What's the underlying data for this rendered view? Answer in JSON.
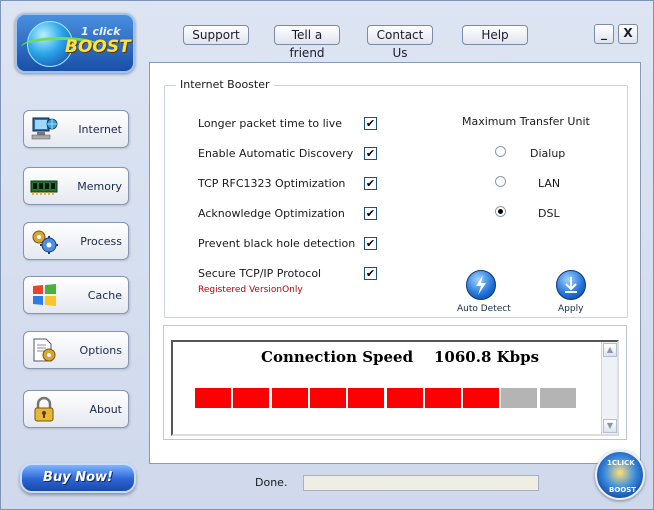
{
  "logo": {
    "line1": "1 click",
    "line2": "BOOST"
  },
  "toolbar": {
    "support": "Support",
    "tell_friend": "Tell a friend",
    "contact": "Contact Us",
    "help": "Help",
    "minimize": "_",
    "close": "X"
  },
  "sidebar": {
    "items": [
      {
        "label": "Internet",
        "icon": "network-computer-icon"
      },
      {
        "label": "Memory",
        "icon": "memory-chip-icon"
      },
      {
        "label": "Process",
        "icon": "gears-icon"
      },
      {
        "label": "Cache",
        "icon": "windows-logo-icon"
      },
      {
        "label": "Options",
        "icon": "document-gear-icon"
      },
      {
        "label": "About",
        "icon": "padlock-icon"
      }
    ],
    "buy_now": "Buy Now!"
  },
  "internet_booster": {
    "title": "Internet  Booster",
    "options": [
      {
        "label": "Longer packet time to live",
        "checked": true
      },
      {
        "label": "Enable Automatic Discovery",
        "checked": true
      },
      {
        "label": "TCP RFC1323 Optimization",
        "checked": true
      },
      {
        "label": "Acknowledge Optimization",
        "checked": true
      },
      {
        "label": "Prevent black hole detection",
        "checked": true
      },
      {
        "label": "Secure TCP/IP Protocol",
        "checked": true
      }
    ],
    "registered_note": "Registered VersionOnly",
    "mtu": {
      "title": "Maximum Transfer Unit",
      "options": [
        {
          "label": "Dialup",
          "selected": false
        },
        {
          "label": "LAN",
          "selected": false
        },
        {
          "label": "DSL",
          "selected": true
        }
      ]
    },
    "auto_detect": "Auto Detect",
    "apply": "Apply"
  },
  "speed": {
    "label": "Connection Speed",
    "value": "1060.8 Kbps",
    "level_segments_filled": 8,
    "level_segments_total": 10,
    "filled_color": "#ff0000",
    "empty_color": "#b4b4b4"
  },
  "status": {
    "text": "Done."
  },
  "badge": {
    "text": "1CLICK BOOST"
  }
}
